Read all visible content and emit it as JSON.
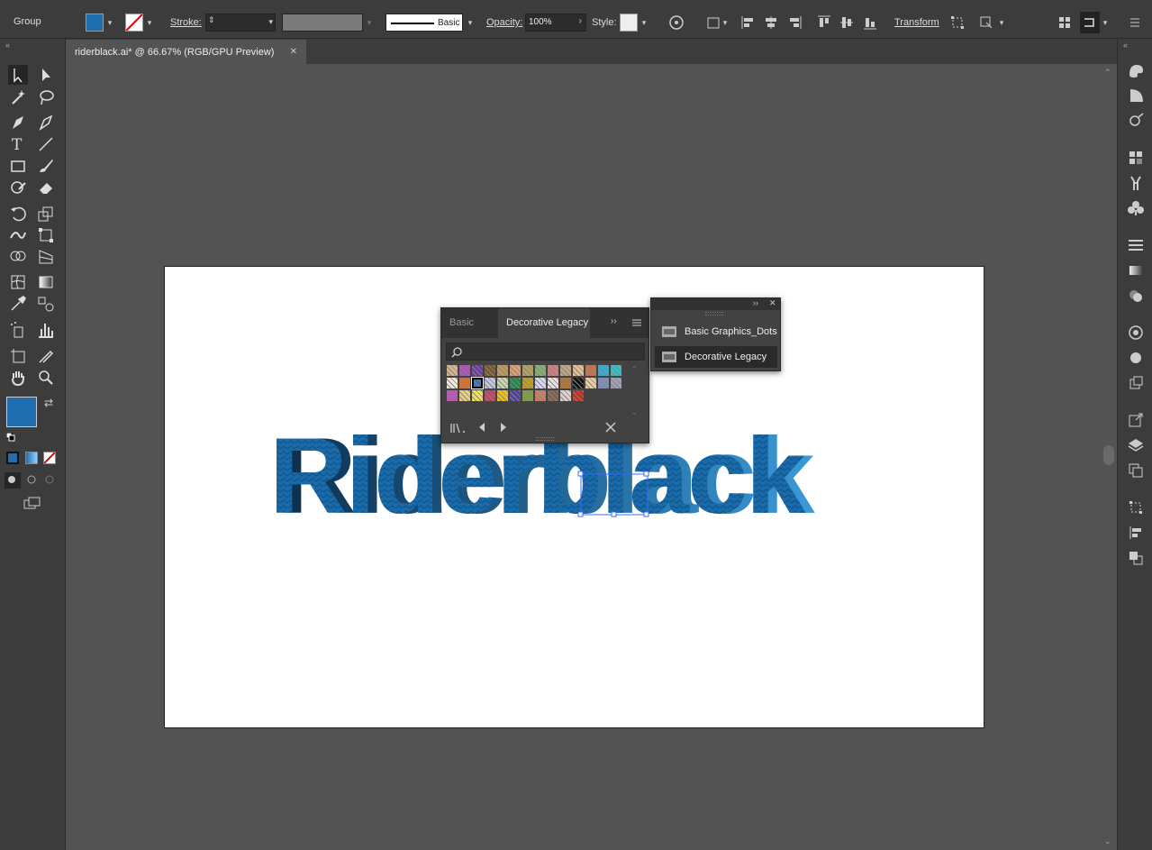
{
  "control_bar": {
    "selection_label": "Group",
    "stroke_label": "Stroke:",
    "brush_label": "Basic",
    "opacity_label": "Opacity:",
    "opacity_value": "100%",
    "style_label": "Style:",
    "transform_label": "Transform",
    "fill_color": "#1f6fb0"
  },
  "document_tab": {
    "title": "riderblack.ai* @ 66.67% (RGB/GPU Preview)",
    "close_glyph": "✕"
  },
  "artwork": {
    "text": "Riderblack",
    "color": "#1a6aa8"
  },
  "swatch_panel": {
    "tabs": [
      "Basic Graph",
      "Decorative Legacy"
    ],
    "active_tab": "Decorative Legacy",
    "search_placeholder": "",
    "pattern_colors": [
      [
        "#d9b48f",
        "#b04fb8",
        "#6a3fa0",
        "#7b5a2a",
        "#c49a5a",
        "#e0a070",
        "#b8a060",
        "#88b070",
        "#d08080",
        "#c0a880",
        "#e8c090",
        "#d07048",
        "#30b0d8",
        "#38c0c8"
      ],
      [
        "#f0e8d8",
        "#e07028",
        "#3a6fb0",
        "#c0c8e0",
        "#c8d8b0",
        "#208848",
        "#c0a020",
        "#d8d8f0",
        "#e8e0e0",
        "#b87030",
        "#101010",
        "#e8d0a0",
        "#8090c0",
        "#a0a0b8"
      ],
      [
        "#c050c0",
        "#e8d080",
        "#f0e060",
        "#c04060",
        "#f0c020",
        "#5040a0",
        "#80a040",
        "#d08060",
        "#806050",
        "#e0d0d0",
        "#c03020"
      ]
    ]
  },
  "library_flyout": {
    "items": [
      "Basic Graphics_Dots",
      "Decorative Legacy"
    ],
    "selected": "Decorative Legacy"
  }
}
